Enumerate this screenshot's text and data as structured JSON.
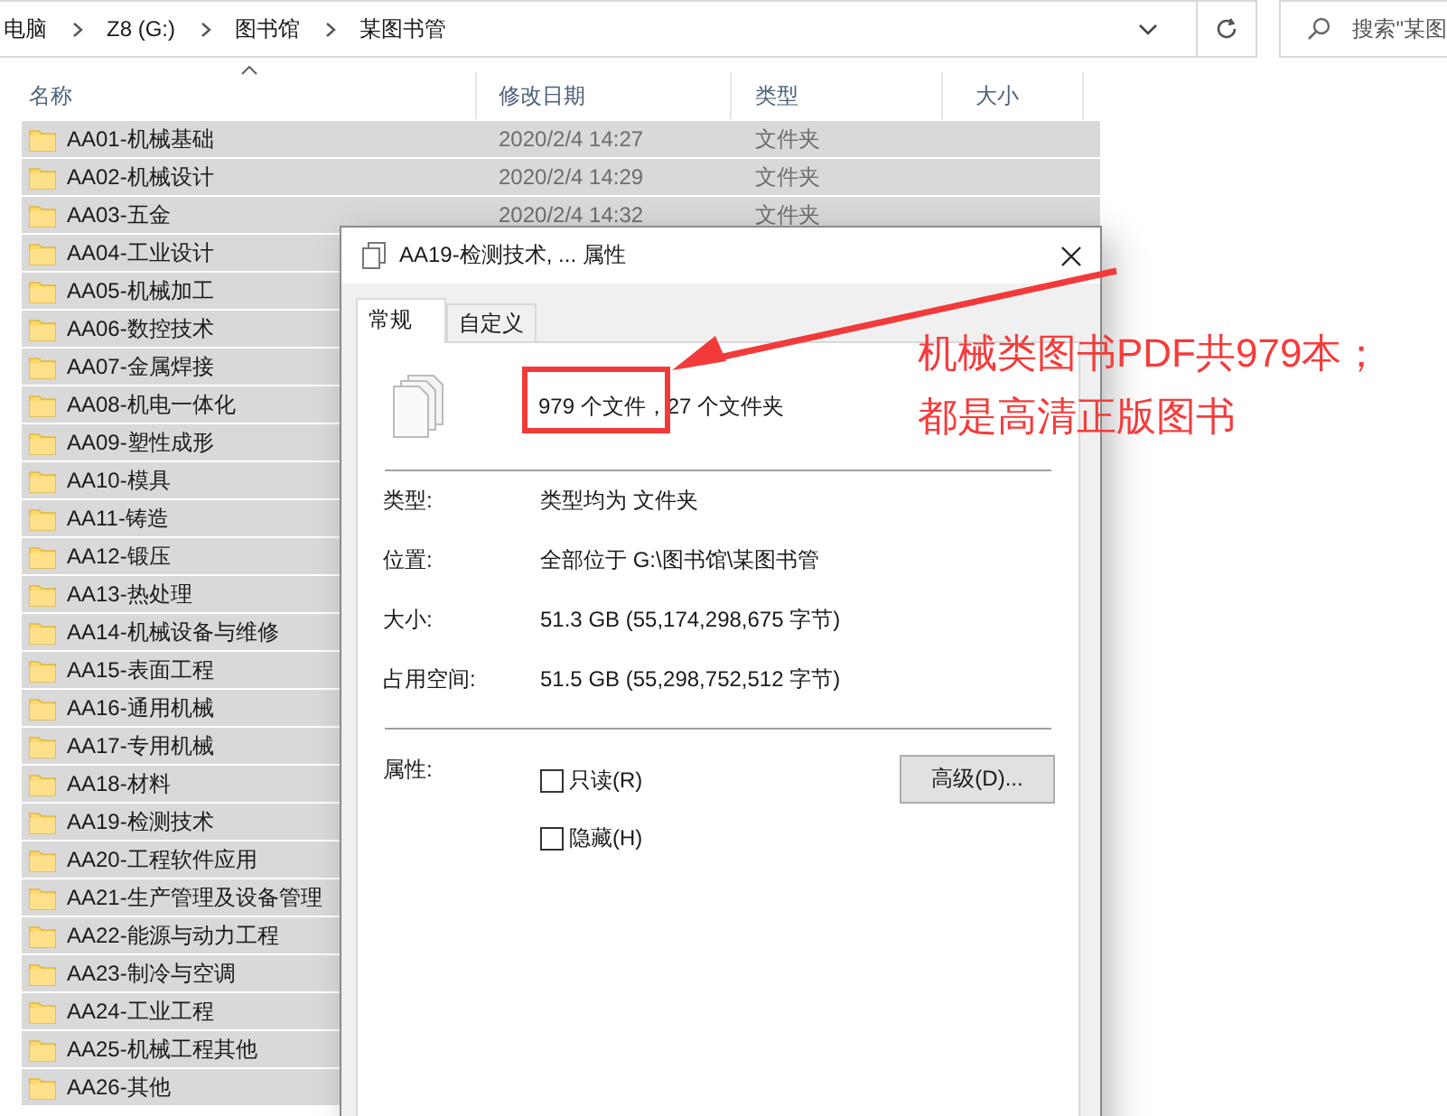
{
  "address_bar": {
    "breadcrumbs": [
      "电脑",
      "Z8 (G:)",
      "图书馆",
      "某图书管"
    ],
    "search": {
      "placeholder": "搜索\"某图"
    }
  },
  "file_list": {
    "columns": [
      {
        "label": "名称",
        "sorted": true
      },
      {
        "label": "修改日期",
        "sorted": false
      },
      {
        "label": "类型",
        "sorted": false
      },
      {
        "label": "大小",
        "sorted": false
      }
    ],
    "rows": [
      {
        "name": "AA01-机械基础",
        "modified": "2020/2/4 14:27",
        "type": "文件夹",
        "selected": true
      },
      {
        "name": "AA02-机械设计",
        "modified": "2020/2/4 14:29",
        "type": "文件夹",
        "selected": true
      },
      {
        "name": "AA03-五金",
        "modified": "2020/2/4 14:32",
        "type": "文件夹",
        "selected": true
      },
      {
        "name": "AA04-工业设计",
        "selected": true
      },
      {
        "name": "AA05-机械加工",
        "selected": true
      },
      {
        "name": "AA06-数控技术",
        "selected": true
      },
      {
        "name": "AA07-金属焊接",
        "selected": true
      },
      {
        "name": "AA08-机电一体化",
        "selected": true
      },
      {
        "name": "AA09-塑性成形",
        "selected": true
      },
      {
        "name": "AA10-模具",
        "selected": true
      },
      {
        "name": "AA11-铸造",
        "selected": true
      },
      {
        "name": "AA12-锻压",
        "selected": true
      },
      {
        "name": "AA13-热处理",
        "selected": true
      },
      {
        "name": "AA14-机械设备与维修",
        "selected": true
      },
      {
        "name": "AA15-表面工程",
        "selected": true
      },
      {
        "name": "AA16-通用机械",
        "selected": true
      },
      {
        "name": "AA17-专用机械",
        "selected": true
      },
      {
        "name": "AA18-材料",
        "selected": true
      },
      {
        "name": "AA19-检测技术",
        "selected": true
      },
      {
        "name": "AA20-工程软件应用",
        "selected": true
      },
      {
        "name": "AA21-生产管理及设备管理",
        "selected": true
      },
      {
        "name": "AA22-能源与动力工程",
        "selected": true
      },
      {
        "name": "AA23-制冷与空调",
        "selected": true
      },
      {
        "name": "AA24-工业工程",
        "selected": true
      },
      {
        "name": "AA25-机械工程其他",
        "selected": true
      },
      {
        "name": "AA26-其他",
        "selected": true
      }
    ]
  },
  "dialog": {
    "title": "AA19-检测技术, ... 属性",
    "tabs": [
      {
        "label": "常规",
        "selected": true
      },
      {
        "label": "自定义",
        "selected": false
      }
    ],
    "summary": "979 个文件，27 个文件夹",
    "properties": [
      {
        "label": "类型:",
        "value": "类型均为 文件夹"
      },
      {
        "label": "位置:",
        "value": "全部位于 G:\\图书馆\\某图书管"
      },
      {
        "label": "大小:",
        "value": "51.3 GB (55,174,298,675 字节)"
      },
      {
        "label": "占用空间:",
        "value": "51.5 GB (55,298,752,512 字节)"
      }
    ],
    "attributes_label": "属性:",
    "attributes": [
      {
        "label": "只读(R)",
        "checked": false
      },
      {
        "label": "隐藏(H)",
        "checked": false
      }
    ],
    "advanced_button": "高级(D)..."
  },
  "annotation": {
    "lines": [
      "机械类图书PDF共979本；",
      "都是高清正版图书"
    ]
  }
}
